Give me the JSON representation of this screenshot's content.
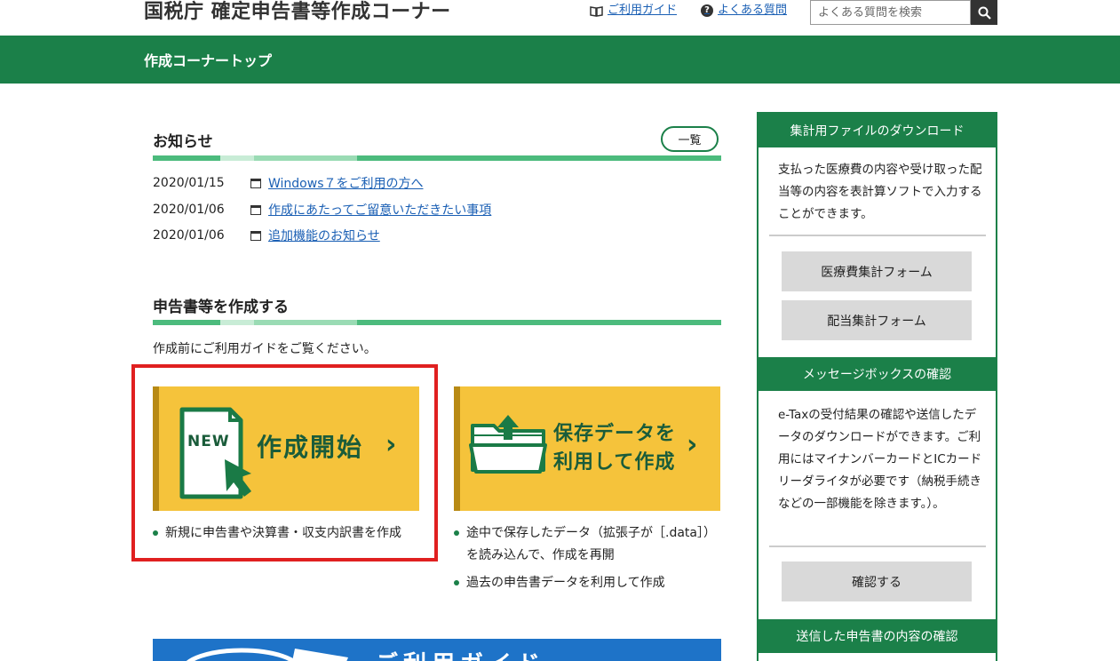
{
  "header": {
    "site_title": "国税庁 確定申告書等作成コーナー",
    "guide_link": "ご利用ガイド",
    "faq_link": "よくある質問",
    "search_placeholder": "よくある質問を検索"
  },
  "breadcrumb": {
    "title": "作成コーナートップ"
  },
  "news": {
    "title": "お知らせ",
    "list_button": "一覧",
    "items": [
      {
        "date": "2020/01/15",
        "text": "Windows７をご利用の方へ"
      },
      {
        "date": "2020/01/06",
        "text": "作成にあたってご留意いただきたい事項"
      },
      {
        "date": "2020/01/06",
        "text": "追加機能のお知らせ"
      }
    ]
  },
  "create": {
    "title": "申告書等を作成する",
    "note": "作成前にご利用ガイドをご覧ください。",
    "new_tile": {
      "badge": "NEW",
      "label": "作成開始",
      "bullets": [
        "新規に申告書や決算書・収支内訳書を作成"
      ]
    },
    "saved_tile": {
      "label_line1": "保存データを",
      "label_line2": "利用して作成",
      "bullets": [
        "途中で保存したデータ（拡張子が［.data］）を読み込んで、作成を再開",
        "過去の申告書データを利用して作成"
      ]
    }
  },
  "banner": {
    "text": "ご利用ガイド"
  },
  "sidebar": {
    "download": {
      "title": "集計用ファイルのダウンロード",
      "text": "支払った医療費の内容や受け取った配当等の内容を表計算ソフトで入力することができます。",
      "buttons": [
        "医療費集計フォーム",
        "配当集計フォーム"
      ]
    },
    "messagebox": {
      "title": "メッセージボックスの確認",
      "text": "e-Taxの受付結果の確認や送信したデータのダウンロードができます。ご利用にはマイナンバーカードとICカードリーダライタが必要です（納税手続きなどの一部機能を除きます。）。",
      "button": "確認する"
    },
    "sent": {
      "title": "送信した申告書の内容の確認"
    }
  },
  "colors": {
    "brand_green": "#1b8049",
    "tile_yellow": "#f5c33b",
    "link_blue": "#1a5fb4",
    "highlight_red": "#e02020"
  }
}
